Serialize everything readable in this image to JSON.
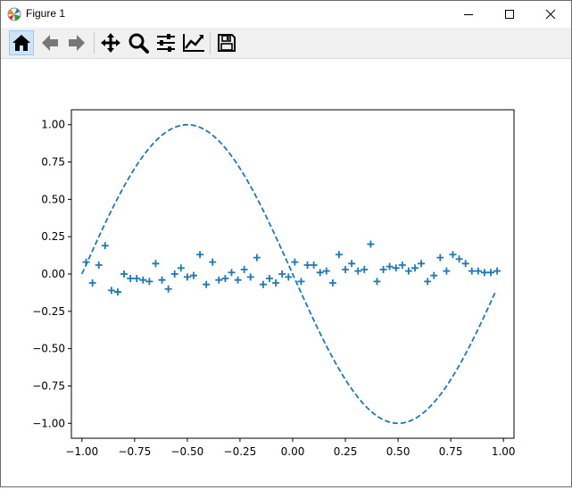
{
  "window": {
    "title": "Figure 1",
    "minimize_glyph": "—",
    "maximize_glyph": "☐",
    "close_glyph": "✕"
  },
  "toolbar": {
    "items": [
      {
        "name": "home-icon",
        "label": "Home"
      },
      {
        "name": "back-arrow-icon",
        "label": "Back"
      },
      {
        "name": "forward-arrow-icon",
        "label": "Forward"
      },
      {
        "name": "pan-icon",
        "label": "Pan"
      },
      {
        "name": "zoom-icon",
        "label": "Zoom"
      },
      {
        "name": "configure-subplots-icon",
        "label": "Subplots"
      },
      {
        "name": "edit-axis-icon",
        "label": "Customize"
      },
      {
        "name": "save-icon",
        "label": "Save"
      }
    ],
    "active": "home-icon"
  },
  "chart_data": {
    "type": "line",
    "title": "",
    "xlabel": "",
    "ylabel": "",
    "xlim": [
      -1.05,
      1.05
    ],
    "ylim": [
      -1.1,
      1.1
    ],
    "xticks": [
      -1.0,
      -0.75,
      -0.5,
      -0.25,
      0.0,
      0.25,
      0.5,
      0.75,
      1.0
    ],
    "xtick_labels": [
      "−1.00",
      "−0.75",
      "−0.50",
      "−0.25",
      "0.00",
      "0.25",
      "0.50",
      "0.75",
      "1.00"
    ],
    "yticks": [
      -1.0,
      -0.75,
      -0.5,
      -0.25,
      0.0,
      0.25,
      0.5,
      0.75,
      1.0
    ],
    "ytick_labels": [
      "−1.00",
      "−0.75",
      "−0.50",
      "−0.25",
      "0.00",
      "0.25",
      "0.50",
      "0.75",
      "1.00"
    ],
    "grid": false,
    "color": "#1f77b4",
    "series": [
      {
        "style": "dashed-line",
        "function": "-sin(pi*x)",
        "x_range": [
          -1.0,
          0.96
        ]
      },
      {
        "style": "plus-markers",
        "x": [
          -0.98,
          -0.95,
          -0.92,
          -0.89,
          -0.86,
          -0.83,
          -0.8,
          -0.77,
          -0.74,
          -0.71,
          -0.68,
          -0.65,
          -0.62,
          -0.59,
          -0.56,
          -0.53,
          -0.5,
          -0.47,
          -0.44,
          -0.41,
          -0.38,
          -0.35,
          -0.32,
          -0.29,
          -0.26,
          -0.23,
          -0.2,
          -0.17,
          -0.14,
          -0.11,
          -0.08,
          -0.05,
          -0.02,
          0.01,
          0.04,
          0.07,
          0.1,
          0.13,
          0.16,
          0.19,
          0.22,
          0.25,
          0.28,
          0.31,
          0.34,
          0.37,
          0.4,
          0.43,
          0.46,
          0.49,
          0.52,
          0.55,
          0.58,
          0.61,
          0.64,
          0.67,
          0.7,
          0.73,
          0.76,
          0.79,
          0.82,
          0.85,
          0.88,
          0.91,
          0.94,
          0.97
        ],
        "y": [
          0.08,
          -0.06,
          0.06,
          0.19,
          -0.11,
          -0.12,
          0.0,
          -0.03,
          -0.03,
          -0.04,
          -0.05,
          0.07,
          -0.04,
          -0.1,
          0.0,
          0.04,
          -0.02,
          -0.01,
          0.13,
          -0.07,
          0.08,
          -0.04,
          -0.03,
          0.01,
          -0.04,
          0.03,
          -0.02,
          0.11,
          -0.07,
          -0.03,
          -0.06,
          0.0,
          -0.02,
          0.08,
          -0.05,
          0.06,
          0.06,
          0.01,
          0.02,
          -0.06,
          0.13,
          0.03,
          0.07,
          0.02,
          0.03,
          0.2,
          -0.05,
          0.03,
          0.05,
          0.04,
          0.06,
          0.02,
          0.04,
          0.07,
          -0.05,
          -0.01,
          0.11,
          0.02,
          0.13,
          0.1,
          0.07,
          0.02,
          0.02,
          0.01,
          0.01,
          0.02
        ]
      }
    ]
  }
}
